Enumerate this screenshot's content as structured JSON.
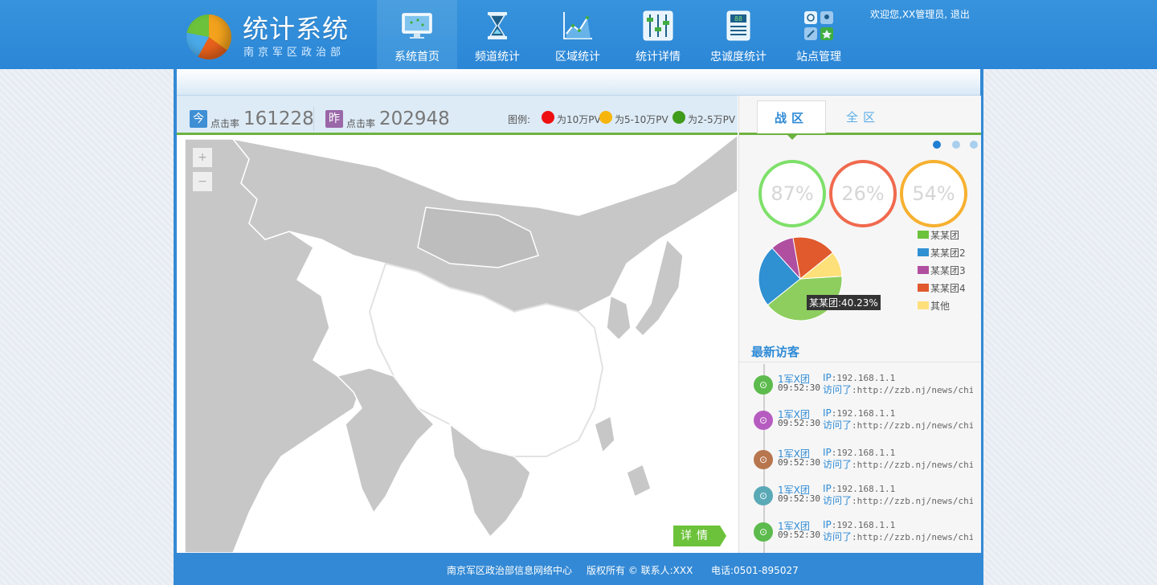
{
  "header": {
    "logo_title": "统计系统",
    "logo_subtitle": "南京军区政治部",
    "user_greeting": "欢迎您,XX管理员,",
    "logout_label": "退出"
  },
  "nav": [
    {
      "label": "系统首页",
      "icon": "monitor-icon",
      "active": true
    },
    {
      "label": "频道统计",
      "icon": "hourglass-icon",
      "active": false
    },
    {
      "label": "区域统计",
      "icon": "line-chart-icon",
      "active": false
    },
    {
      "label": "统计详情",
      "icon": "sliders-icon",
      "active": false
    },
    {
      "label": "忠诚度统计",
      "icon": "calculator-icon",
      "active": false
    },
    {
      "label": "站点管理",
      "icon": "grid-apps-icon",
      "active": false
    }
  ],
  "stats": {
    "today": {
      "badge": "今",
      "label": "点击率",
      "value": "161228",
      "color": "#3e8fd4"
    },
    "yesterday": {
      "badge": "昨",
      "label": "点击率",
      "value": "202948",
      "color": "#9a67a8"
    }
  },
  "map_legend": {
    "title": "图例:",
    "items": [
      {
        "label": "为10万PV",
        "color": "#ee1010"
      },
      {
        "label": "为5-10万PV",
        "color": "#f6b50a"
      },
      {
        "label": "为2-5万PV",
        "color": "#3f9b1c"
      }
    ]
  },
  "map": {
    "zoom_in": "+",
    "zoom_out": "−",
    "details_label": "详情"
  },
  "side": {
    "tabs": [
      {
        "label": "战区",
        "active": true
      },
      {
        "label": "全区",
        "active": false
      }
    ],
    "pager": {
      "count": 3,
      "active": 0
    },
    "rings": [
      {
        "value": "87%",
        "color": "#7ee06a"
      },
      {
        "value": "26%",
        "color": "#f06a4e"
      },
      {
        "value": "54%",
        "color": "#f7b030"
      }
    ],
    "tooltip": "某某团:40.23%"
  },
  "chart_data": {
    "type": "pie",
    "slices": [
      {
        "label": "某某团",
        "value": 40.23,
        "color": "#8dce5f"
      },
      {
        "label": "某某团2",
        "value": 24,
        "color": "#2f90d2"
      },
      {
        "label": "某某团3",
        "value": 9,
        "color": "#b04fa0"
      },
      {
        "label": "某某团4",
        "value": 17,
        "color": "#e05a2e"
      },
      {
        "label": "其他",
        "value": 9.77,
        "color": "#fde07a"
      }
    ]
  },
  "visitors": {
    "title": "最新访客",
    "ip_label": "IP",
    "visited_label": "访问了",
    "items": [
      {
        "name": "1军X团",
        "time": "09:52:30",
        "ip": ":192.168.1.1",
        "url": ":http://zzb.nj/news/china",
        "color": "#5cbb4c"
      },
      {
        "name": "1军X团",
        "time": "09:52:30",
        "ip": ":192.168.1.1",
        "url": ":http://zzb.nj/news/china",
        "color": "#b65cc0"
      },
      {
        "name": "1军X团",
        "time": "09:52:30",
        "ip": ":192.168.1.1",
        "url": ":http://zzb.nj/news/china",
        "color": "#b8764e"
      },
      {
        "name": "1军X团",
        "time": "09:52:30",
        "ip": ":192.168.1.1",
        "url": ":http://zzb.nj/news/china",
        "color": "#5aa9b6"
      },
      {
        "name": "1军X团",
        "time": "09:52:30",
        "ip": ":192.168.1.1",
        "url": ":http://zzb.nj/news/china",
        "color": "#5cbb4c"
      }
    ]
  },
  "footer": {
    "org": "南京军区政治部信息网络中心",
    "copyright": "版权所有 © 联系人:XXX",
    "phone": "电话:0501-895027"
  }
}
